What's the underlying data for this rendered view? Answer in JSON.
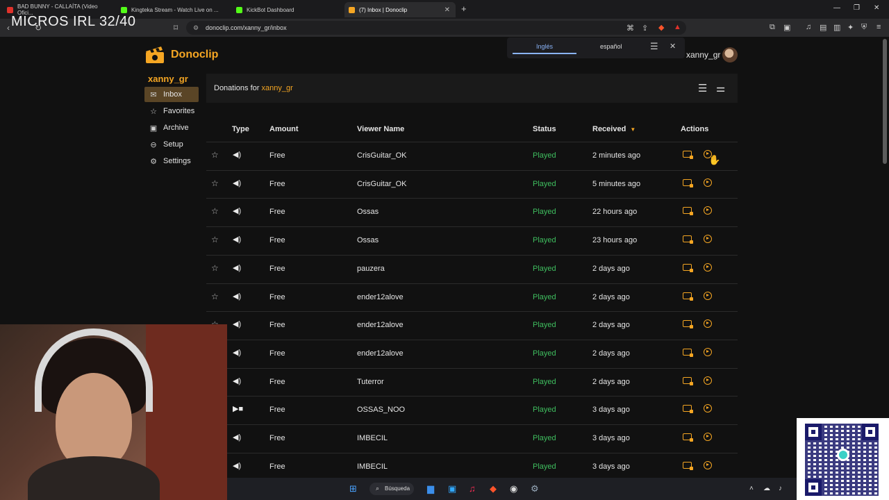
{
  "browser": {
    "tabs": [
      {
        "title": "BAD BUNNY - CALLAÍTA (Video Ofici...",
        "color": "#e0322b"
      },
      {
        "title": "Kingteka Stream - Watch Live on ...",
        "color": "#53fc18"
      },
      {
        "title": "KickBot Dashboard",
        "color": "#53fc18"
      },
      {
        "title": "(7) Inbox | Donoclip",
        "color": "#f5a623"
      }
    ],
    "url": "donoclip.com/xanny_gr/inbox"
  },
  "overlay_text": "MICROS IRL 32/40",
  "translate_popup": {
    "lang_from": "Inglés",
    "lang_to": "español"
  },
  "app": {
    "logo_text": "Donoclip",
    "username": "xanny_gr",
    "channel": "xanny_gr",
    "sidebar": [
      {
        "label": "Inbox",
        "icon": "inbox-icon",
        "active": true
      },
      {
        "label": "Favorites",
        "icon": "star-icon"
      },
      {
        "label": "Archive",
        "icon": "archive-icon"
      },
      {
        "label": "Setup",
        "icon": "link-icon"
      },
      {
        "label": "Settings",
        "icon": "gear-icon"
      }
    ],
    "panel": {
      "title_prefix": "Donations for ",
      "title_channel": "xanny_gr"
    },
    "columns": [
      "Type",
      "Amount",
      "Viewer Name",
      "Status",
      "Received",
      "Actions"
    ],
    "rows": [
      {
        "type": "audio",
        "amount": "Free",
        "viewer": "CrisGuitar_OK",
        "status": "Played",
        "received": "2 minutes ago"
      },
      {
        "type": "audio",
        "amount": "Free",
        "viewer": "CrisGuitar_OK",
        "status": "Played",
        "received": "5 minutes ago"
      },
      {
        "type": "audio",
        "amount": "Free",
        "viewer": "Ossas",
        "status": "Played",
        "received": "22 hours ago"
      },
      {
        "type": "audio",
        "amount": "Free",
        "viewer": "Ossas",
        "status": "Played",
        "received": "23 hours ago"
      },
      {
        "type": "audio",
        "amount": "Free",
        "viewer": "pauzera",
        "status": "Played",
        "received": "2 days ago"
      },
      {
        "type": "audio",
        "amount": "Free",
        "viewer": "ender12alove",
        "status": "Played",
        "received": "2 days ago"
      },
      {
        "type": "audio",
        "amount": "Free",
        "viewer": "ender12alove",
        "status": "Played",
        "received": "2 days ago"
      },
      {
        "type": "audio",
        "amount": "Free",
        "viewer": "ender12alove",
        "status": "Played",
        "received": "2 days ago"
      },
      {
        "type": "audio",
        "amount": "Free",
        "viewer": "Tuterror",
        "status": "Played",
        "received": "2 days ago"
      },
      {
        "type": "video",
        "amount": "Free",
        "viewer": "OSSAS_NOO",
        "status": "Played",
        "received": "3 days ago"
      },
      {
        "type": "audio",
        "amount": "Free",
        "viewer": "IMBECIL",
        "status": "Played",
        "received": "3 days ago"
      },
      {
        "type": "audio",
        "amount": "Free",
        "viewer": "IMBECIL",
        "status": "Played",
        "received": "3 days ago"
      }
    ]
  },
  "taskbar": {
    "search_label": "Búsqueda"
  },
  "colors": {
    "accent": "#f5a623",
    "status_played": "#3fbf5f",
    "background": "#111111"
  }
}
